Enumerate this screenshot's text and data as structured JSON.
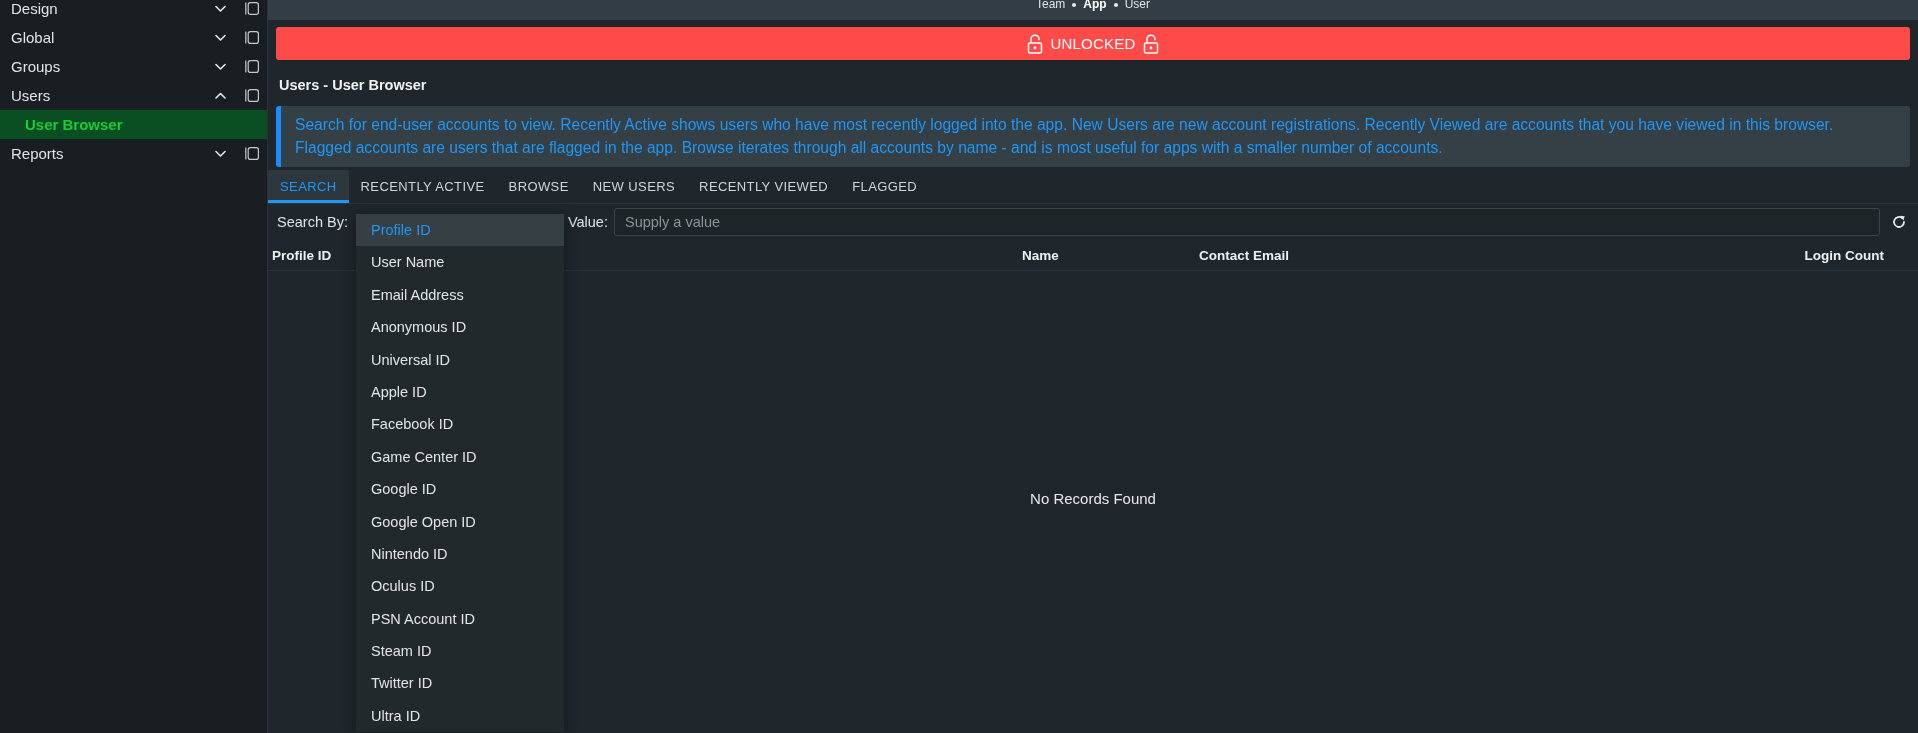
{
  "topbar": {
    "breadcrumb": [
      {
        "label": "Team",
        "selected": false
      },
      {
        "label": "App",
        "selected": true
      },
      {
        "label": "User",
        "selected": false
      }
    ]
  },
  "sidebar": {
    "items": [
      {
        "label": "Design",
        "expanded": false,
        "selected": false
      },
      {
        "label": "Global",
        "expanded": false,
        "selected": false
      },
      {
        "label": "Groups",
        "expanded": false,
        "selected": false
      },
      {
        "label": "Users",
        "expanded": true,
        "selected": false,
        "children": [
          {
            "label": "User Browser",
            "selected": true
          }
        ]
      },
      {
        "label": "Reports",
        "expanded": false,
        "selected": false
      }
    ]
  },
  "lock_banner": {
    "label": "UNLOCKED",
    "locked": false
  },
  "page_title": "Users - User Browser",
  "info_message": "Search for end-user accounts to view. Recently Active shows users who have most recently logged into the app. New Users are new account registrations. Recently Viewed are accounts that you have viewed in this browser. Flagged accounts are users that are flagged in the app. Browse iterates through all accounts by name - and is most useful for apps with a smaller number of accounts.",
  "tabs": [
    {
      "label": "SEARCH",
      "selected": true
    },
    {
      "label": "RECENTLY ACTIVE",
      "selected": false
    },
    {
      "label": "BROWSE",
      "selected": false
    },
    {
      "label": "NEW USERS",
      "selected": false
    },
    {
      "label": "RECENTLY VIEWED",
      "selected": false
    },
    {
      "label": "FLAGGED",
      "selected": false
    }
  ],
  "search": {
    "search_by": {
      "label": "Search By:",
      "open": true,
      "options": [
        {
          "label": "Profile ID",
          "selected": true
        },
        {
          "label": "User Name",
          "selected": false
        },
        {
          "label": "Email Address",
          "selected": false
        },
        {
          "label": "Anonymous ID",
          "selected": false
        },
        {
          "label": "Universal ID",
          "selected": false
        },
        {
          "label": "Apple ID",
          "selected": false
        },
        {
          "label": "Facebook ID",
          "selected": false
        },
        {
          "label": "Game Center ID",
          "selected": false
        },
        {
          "label": "Google ID",
          "selected": false
        },
        {
          "label": "Google Open ID",
          "selected": false
        },
        {
          "label": "Nintendo ID",
          "selected": false
        },
        {
          "label": "Oculus ID",
          "selected": false
        },
        {
          "label": "PSN Account ID",
          "selected": false
        },
        {
          "label": "Steam ID",
          "selected": false
        },
        {
          "label": "Twitter ID",
          "selected": false
        },
        {
          "label": "Ultra ID",
          "selected": false
        }
      ]
    },
    "value": {
      "label": "Value:",
      "placeholder": "Supply a value"
    }
  },
  "table": {
    "columns": [
      "Profile ID",
      "Name",
      "Contact Email",
      "Login Count"
    ],
    "empty_message": "No Records Found"
  }
}
